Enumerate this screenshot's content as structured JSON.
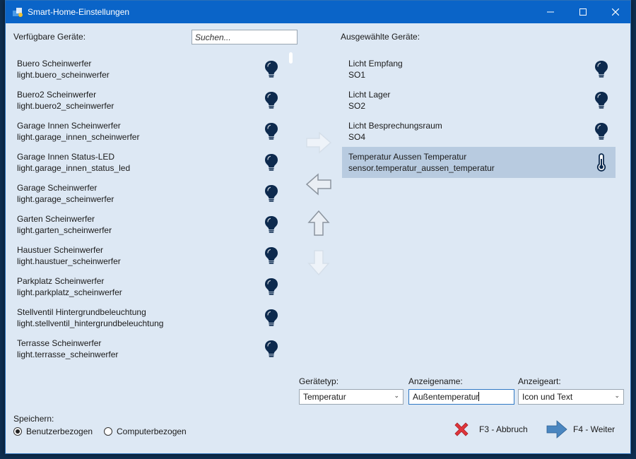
{
  "window": {
    "title": "Smart-Home-Einstellungen"
  },
  "available": {
    "label": "Verfügbare Geräte:",
    "search_placeholder": "Suchen...",
    "items": [
      {
        "name": "Buero Scheinwerfer",
        "id": "light.buero_scheinwerfer",
        "icon": "bulb-icon"
      },
      {
        "name": "Buero2 Scheinwerfer",
        "id": "light.buero2_scheinwerfer",
        "icon": "bulb-icon"
      },
      {
        "name": "Garage Innen Scheinwerfer",
        "id": "light.garage_innen_scheinwerfer",
        "icon": "bulb-icon"
      },
      {
        "name": "Garage Innen Status-LED",
        "id": "light.garage_innen_status_led",
        "icon": "bulb-icon"
      },
      {
        "name": "Garage Scheinwerfer",
        "id": "light.garage_scheinwerfer",
        "icon": "bulb-icon"
      },
      {
        "name": "Garten Scheinwerfer",
        "id": "light.garten_scheinwerfer",
        "icon": "bulb-icon"
      },
      {
        "name": "Haustuer Scheinwerfer",
        "id": "light.haustuer_scheinwerfer",
        "icon": "bulb-icon"
      },
      {
        "name": "Parkplatz Scheinwerfer",
        "id": "light.parkplatz_scheinwerfer",
        "icon": "bulb-icon"
      },
      {
        "name": "Stellventil Hintergrundbeleuchtung",
        "id": "light.stellventil_hintergrundbeleuchtung",
        "icon": "bulb-icon"
      },
      {
        "name": "Terrasse Scheinwerfer",
        "id": "light.terrasse_scheinwerfer",
        "icon": "bulb-icon"
      }
    ]
  },
  "selected": {
    "label": "Ausgewählte Geräte:",
    "items": [
      {
        "name": "Licht Empfang",
        "id": "SO1",
        "icon": "bulb-icon",
        "selected": false
      },
      {
        "name": "Licht Lager",
        "id": "SO2",
        "icon": "bulb-icon",
        "selected": false
      },
      {
        "name": "Licht Besprechungsraum",
        "id": "SO4",
        "icon": "bulb-icon",
        "selected": false
      },
      {
        "name": "Temperatur Aussen Temperatur",
        "id": "sensor.temperatur_aussen_temperatur",
        "icon": "thermometer-icon",
        "selected": true
      }
    ]
  },
  "move_buttons": {
    "right": {
      "icon": "arrow-right-icon",
      "enabled": false
    },
    "left": {
      "icon": "arrow-left-icon",
      "enabled": true
    },
    "up": {
      "icon": "arrow-up-icon",
      "enabled": true
    },
    "down": {
      "icon": "arrow-down-icon",
      "enabled": false
    }
  },
  "fields": {
    "device_type": {
      "label": "Gerätetyp:",
      "value": "Temperatur"
    },
    "display_name": {
      "label": "Anzeigename:",
      "value": "Außentemperatur"
    },
    "display_mode": {
      "label": "Anzeigeart:",
      "value": "Icon und Text"
    }
  },
  "save": {
    "label": "Speichern:",
    "options": [
      {
        "label": "Benutzerbezogen",
        "checked": true
      },
      {
        "label": "Computerbezogen",
        "checked": false
      }
    ]
  },
  "actions": {
    "cancel": {
      "label": "F3 - Abbruch",
      "icon": "red-x-icon"
    },
    "next": {
      "label": "F4 - Weiter",
      "icon": "arrow-right-icon"
    }
  },
  "colors": {
    "titlebar": "#0a64c8",
    "window_bg": "#dde8f4",
    "icon_navy": "#0d2a4e",
    "selection": "#b8cbe0",
    "cancel_red": "#e0353b",
    "next_blue": "#4a86c0"
  }
}
